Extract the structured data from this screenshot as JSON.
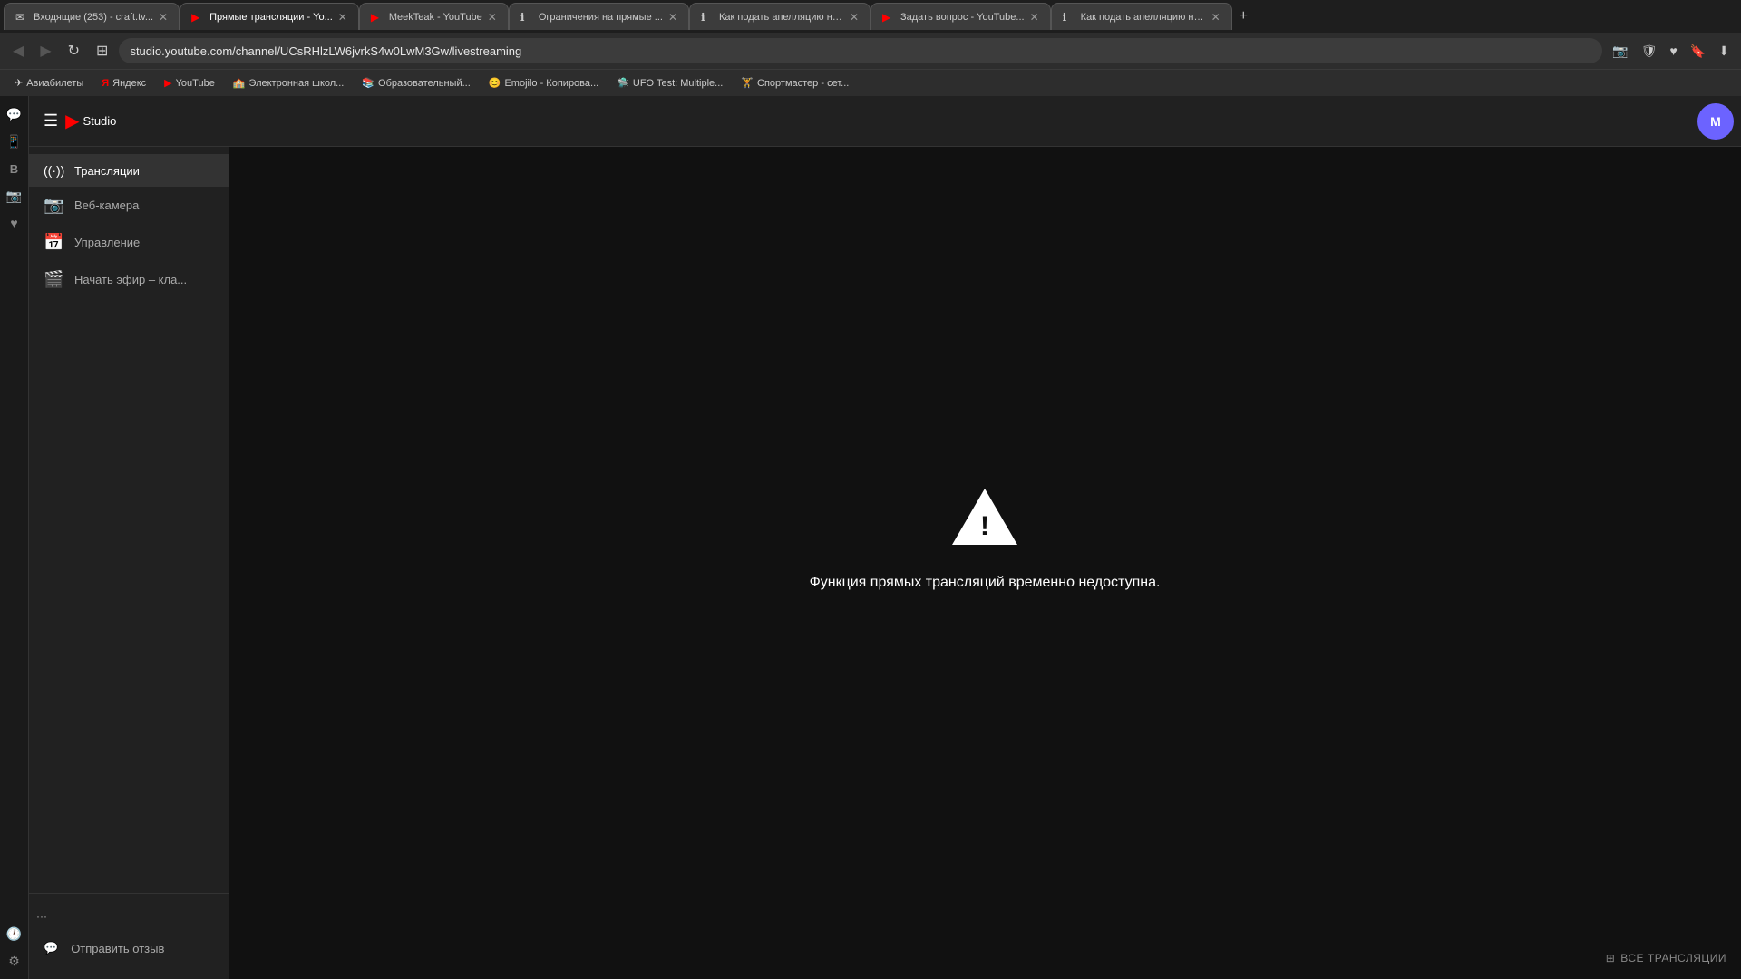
{
  "browser": {
    "tabs": [
      {
        "id": "tab1",
        "title": "Входящие (253) - craft.tv...",
        "favicon": "✉",
        "active": false,
        "closable": true
      },
      {
        "id": "tab2",
        "title": "Прямые трансляции - Yo...",
        "favicon": "▶",
        "active": true,
        "closable": true
      },
      {
        "id": "tab3",
        "title": "MeekTeak - YouTube",
        "favicon": "▶",
        "active": false,
        "closable": true
      },
      {
        "id": "tab4",
        "title": "Ограничения на прямые ...",
        "favicon": "ℹ",
        "active": false,
        "closable": true
      },
      {
        "id": "tab5",
        "title": "Как подать апелляцию на...",
        "favicon": "ℹ",
        "active": false,
        "closable": true
      },
      {
        "id": "tab6",
        "title": "Задать вопрос - YouTube...",
        "favicon": "▶",
        "active": false,
        "closable": true
      },
      {
        "id": "tab7",
        "title": "Как подать апелляцию на...",
        "favicon": "ℹ",
        "active": false,
        "closable": true
      }
    ],
    "address": "studio.youtube.com/channel/UCsRHlzLW6jvrkS4w0LwM3Gw/livestreaming",
    "bookmarks": [
      {
        "label": "Авиабилеты",
        "icon": "✈"
      },
      {
        "label": "Яндекс",
        "icon": "Я"
      },
      {
        "label": "YouTube",
        "icon": "▶"
      },
      {
        "label": "Электронная школ...",
        "icon": "🏫"
      },
      {
        "label": "Образовательный...",
        "icon": "📚"
      },
      {
        "label": "Emojilo - Копирова...",
        "icon": "😊"
      },
      {
        "label": "UFO Test: Multiple...",
        "icon": "🛸"
      },
      {
        "label": "Спортмастер - сет...",
        "icon": "🏋"
      }
    ]
  },
  "social_sidebar": {
    "icons": [
      {
        "id": "messenger",
        "symbol": "💬"
      },
      {
        "id": "whatsapp",
        "symbol": "📱"
      },
      {
        "id": "vk",
        "symbol": "В"
      },
      {
        "id": "instagram",
        "symbol": "📷"
      },
      {
        "id": "heart",
        "symbol": "♥"
      },
      {
        "id": "history",
        "symbol": "🕐"
      },
      {
        "id": "settings",
        "symbol": "⚙"
      }
    ]
  },
  "studio": {
    "logo": {
      "icon": "▶",
      "brand": "Studio"
    },
    "sidebar_items": [
      {
        "id": "broadcasts",
        "label": "Трансляции",
        "icon": "((·))",
        "active": true
      },
      {
        "id": "webcam",
        "label": "Веб-камера",
        "icon": "📷"
      },
      {
        "id": "manage",
        "label": "Управление",
        "icon": "📅"
      },
      {
        "id": "go-live",
        "label": "Начать эфир – кла...",
        "icon": "🎬"
      }
    ],
    "feedback": {
      "icon": "💬",
      "label": "Отправить отзыв"
    },
    "more_btn": "...",
    "all_broadcasts_btn": "ВСЕ ТРАНСЛЯЦИИ",
    "error_message": "Функция прямых трансляций временно недоступна.",
    "avatar_initials": "М"
  }
}
